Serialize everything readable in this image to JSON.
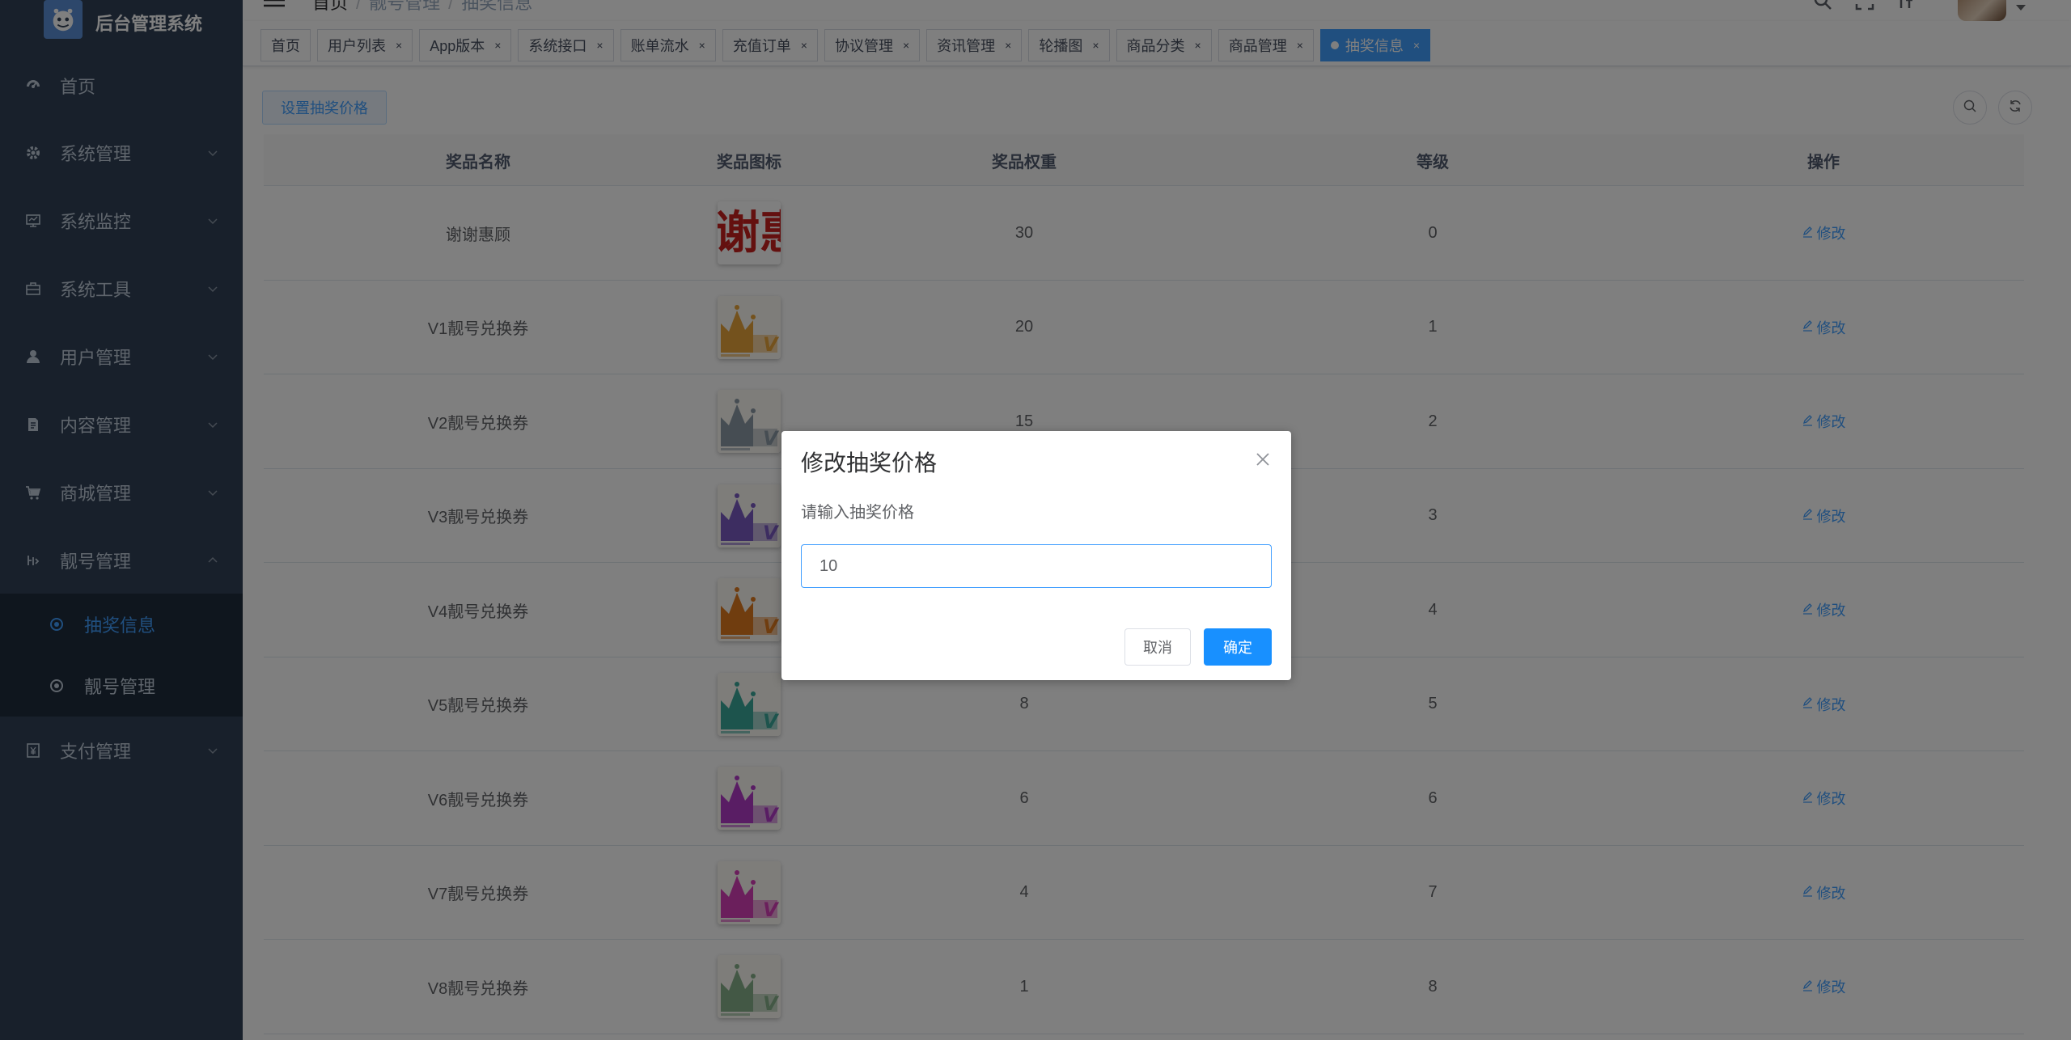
{
  "app": {
    "title": "后台管理系统"
  },
  "sidebar": {
    "items": [
      {
        "label": "首页",
        "icon": "dashboard-icon"
      },
      {
        "label": "系统管理",
        "icon": "gear-icon"
      },
      {
        "label": "系统监控",
        "icon": "monitor-icon"
      },
      {
        "label": "系统工具",
        "icon": "toolbox-icon"
      },
      {
        "label": "用户管理",
        "icon": "user-icon"
      },
      {
        "label": "内容管理",
        "icon": "document-icon"
      },
      {
        "label": "商城管理",
        "icon": "cart-icon"
      },
      {
        "label": "靓号管理",
        "icon": "number-icon"
      },
      {
        "label": "支付管理",
        "icon": "payment-icon"
      }
    ],
    "submenu": [
      {
        "label": "抽奖信息",
        "active": true
      },
      {
        "label": "靓号管理",
        "active": false
      }
    ]
  },
  "breadcrumb": [
    "首页",
    "靓号管理",
    "抽奖信息"
  ],
  "tags": [
    {
      "label": "首页",
      "closable": false,
      "active": false
    },
    {
      "label": "用户列表",
      "closable": true,
      "active": false
    },
    {
      "label": "App版本",
      "closable": true,
      "active": false
    },
    {
      "label": "系统接口",
      "closable": true,
      "active": false
    },
    {
      "label": "账单流水",
      "closable": true,
      "active": false
    },
    {
      "label": "充值订单",
      "closable": true,
      "active": false
    },
    {
      "label": "协议管理",
      "closable": true,
      "active": false
    },
    {
      "label": "资讯管理",
      "closable": true,
      "active": false
    },
    {
      "label": "轮播图",
      "closable": true,
      "active": false
    },
    {
      "label": "商品分类",
      "closable": true,
      "active": false
    },
    {
      "label": "商品管理",
      "closable": true,
      "active": false
    },
    {
      "label": "抽奖信息",
      "closable": true,
      "active": true
    }
  ],
  "toolbar": {
    "set_price_label": "设置抽奖价格"
  },
  "table": {
    "headers": [
      "奖品名称",
      "奖品图标",
      "奖品权重",
      "等级",
      "操作"
    ],
    "edit_label": "修改",
    "rows": [
      {
        "name": "谢谢惠顾",
        "weight": "30",
        "level": "0",
        "color": "thanks"
      },
      {
        "name": "V1靓号兑换券",
        "weight": "20",
        "level": "1",
        "color": "#e9a53b"
      },
      {
        "name": "V2靓号兑换券",
        "weight": "15",
        "level": "2",
        "color": "#8c9aa6"
      },
      {
        "name": "V3靓号兑换券",
        "weight": "",
        "level": "3",
        "color": "#7a5bc2"
      },
      {
        "name": "V4靓号兑换券",
        "weight": "",
        "level": "4",
        "color": "#e07a1f"
      },
      {
        "name": "V5靓号兑换券",
        "weight": "8",
        "level": "5",
        "color": "#3aa89b"
      },
      {
        "name": "V6靓号兑换券",
        "weight": "6",
        "level": "6",
        "color": "#b23ac9"
      },
      {
        "name": "V7靓号兑换券",
        "weight": "4",
        "level": "7",
        "color": "#d63fb8"
      },
      {
        "name": "V8靓号兑换券",
        "weight": "1",
        "level": "8",
        "color": "#86b08a"
      }
    ]
  },
  "dialog": {
    "title": "修改抽奖价格",
    "message": "请输入抽奖价格",
    "input_value": "10",
    "cancel_label": "取消",
    "confirm_label": "确定"
  }
}
